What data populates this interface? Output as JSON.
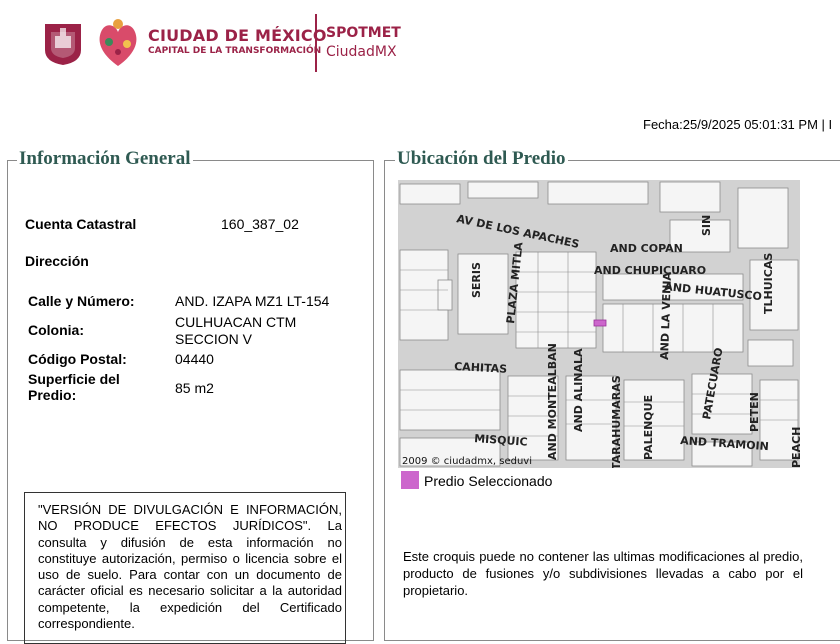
{
  "header": {
    "brand_title": "CIUDAD DE MÉXICO",
    "brand_subtitle": "CAPITAL DE LA TRANSFORMACIÓN",
    "app_name_1": "SPOTMET",
    "app_name_2": "CiudadMX",
    "fecha": "Fecha:25/9/2025 05:01:31 PM | I",
    "brand_color": "#9b2247"
  },
  "info": {
    "legend": "Información General",
    "cuenta_label": "Cuenta Catastral",
    "cuenta_value": "160_387_02",
    "direccion_label": "Dirección",
    "calle_label": "Calle y Número:",
    "calle_value": "AND. IZAPA MZ1 LT-154",
    "colonia_label": "Colonia:",
    "colonia_value": "CULHUACAN CTM SECCION V",
    "cp_label": "Código Postal:",
    "cp_value": "04440",
    "superficie_label": "Superficie del Predio:",
    "superficie_value": "85 m2",
    "notice": "\"VERSIÓN DE DIVULGACIÓN E INFORMACIÓN, NO PRODUCE EFECTOS JURÍDICOS\". La consulta y difusión de esta información no constituye autorización, permiso o licencia sobre el uso de suelo. Para contar con un documento de carácter oficial es necesario solicitar a la autoridad competente, la expedición del Certificado correspondiente."
  },
  "ubicacion": {
    "legend": "Ubicación del Predio",
    "map_streets": [
      "AV DE LOS APACHES",
      "AND COPAN",
      "AND CHUPICUARO",
      "AND HUATUSCO",
      "SERIS",
      "PLAZA MITLA",
      "CAHITAS",
      "AND MONTEALBAN",
      "AND ALINALA",
      "TARAHUMARAS",
      "PALENQUE",
      "AND LA VENIA",
      "PATECUARO",
      "PETEN",
      "AND TRAMOIN",
      "MISQUIC",
      "TLHUICAS",
      "SIN",
      "PEACH"
    ],
    "copyright": "2009 © ciudadmx, seduvi",
    "swatch_color": "#cc66cc",
    "swatch_label": "Predio Seleccionado",
    "disclaimer": "Este croquis puede no contener las ultimas modificaciones al predio, producto de fusiones y/o subdivisiones llevadas a cabo por el propietario."
  }
}
